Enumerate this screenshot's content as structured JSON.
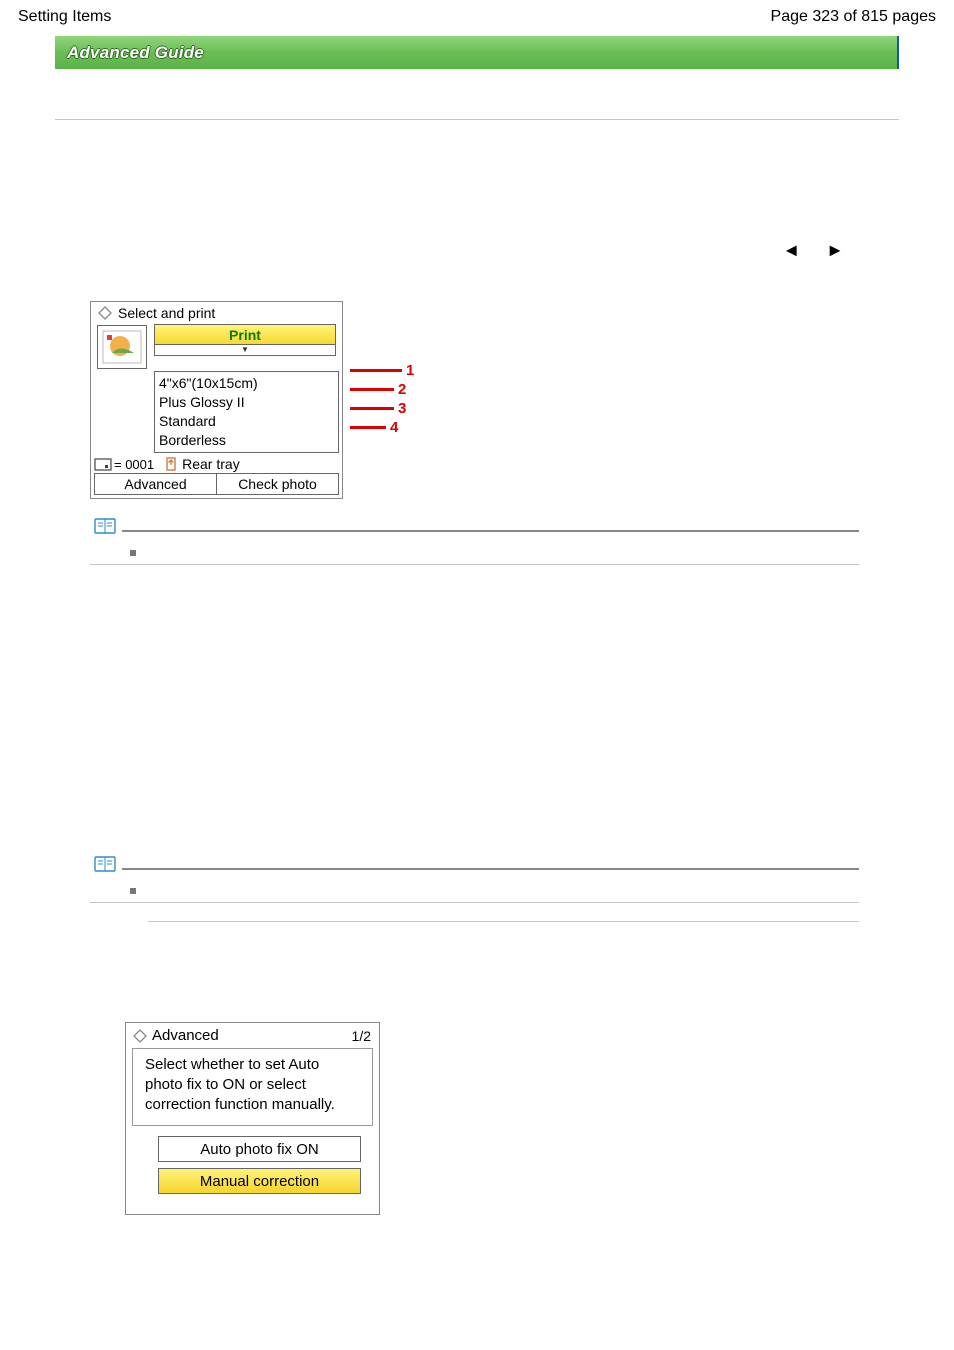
{
  "header": {
    "left": "Setting Items",
    "right": "Page 323 of 815 pages"
  },
  "guide_banner": "Advanced Guide",
  "panel1": {
    "title": "Select and print",
    "print_label": "Print",
    "settings": {
      "size": "4\"x6\"(10x15cm)",
      "media": "Plus Glossy II",
      "quality": "Standard",
      "border": "Borderless"
    },
    "count_label": "= 0001",
    "tray_label": "Rear tray",
    "advanced_btn": "Advanced",
    "check_photo_btn": "Check photo",
    "callouts": [
      "1",
      "2",
      "3",
      "4"
    ]
  },
  "panel2": {
    "title": "Advanced",
    "page": "1/2",
    "desc_l1": "Select whether to set Auto",
    "desc_l2": "photo fix to ON or select",
    "desc_l3": "correction function manually.",
    "opt_auto": "Auto photo fix ON",
    "opt_manual": "Manual correction"
  }
}
